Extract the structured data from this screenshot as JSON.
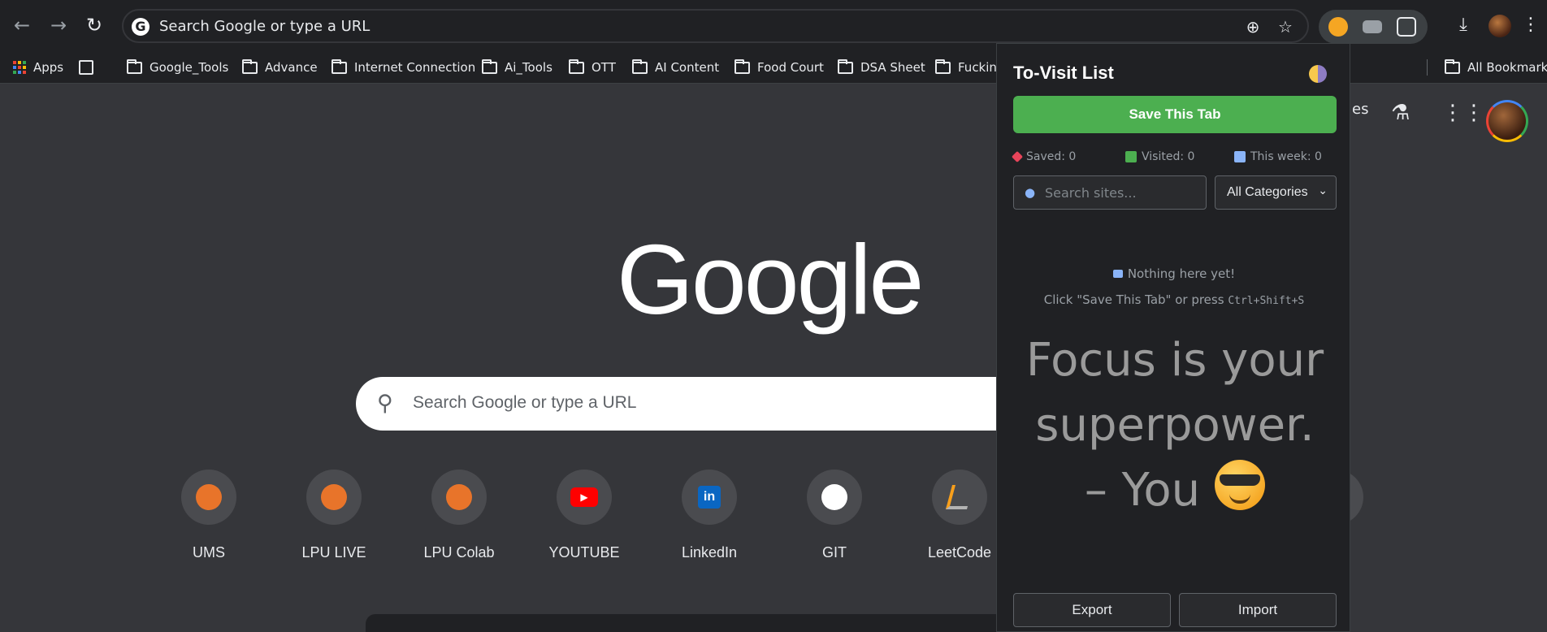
{
  "browser": {
    "omnibox_text": "Search Google or type a URL",
    "bookmarks": [
      {
        "label": "Apps",
        "icon": "apps-icon"
      },
      {
        "label": "Google_Tools",
        "icon": "folder-icon"
      },
      {
        "label": "Advance",
        "icon": "folder-icon"
      },
      {
        "label": "Internet Connection",
        "icon": "folder-icon"
      },
      {
        "label": "Ai_Tools",
        "icon": "folder-icon"
      },
      {
        "label": "OTT",
        "icon": "folder-icon"
      },
      {
        "label": "AI Content",
        "icon": "folder-icon"
      },
      {
        "label": "Food Court",
        "icon": "folder-icon"
      },
      {
        "label": "DSA Sheet",
        "icon": "folder-icon"
      },
      {
        "label": "Fuckin",
        "icon": "folder-icon"
      }
    ],
    "all_bookmarks": "All Bookmarks"
  },
  "newtab": {
    "logo_text": "Google",
    "search_placeholder": "Search Google or type a URL",
    "right_partial_text": "es",
    "shortcuts": [
      {
        "label": "UMS",
        "color": "#e8742a"
      },
      {
        "label": "LPU LIVE",
        "color": "#e8742a"
      },
      {
        "label": "LPU Colab",
        "color": "#e8742a"
      },
      {
        "label": "YOUTUBE",
        "color": "#ff0000"
      },
      {
        "label": "LinkedIn",
        "color": "#0a66c2"
      },
      {
        "label": "GIT",
        "color": "#ffffff"
      },
      {
        "label": "LeetCode",
        "color": "#f89f1b"
      }
    ]
  },
  "popup": {
    "title": "To-Visit List",
    "save_button": "Save This Tab",
    "stats": [
      {
        "label": "Saved: 0",
        "icon": "pin-icon",
        "color": "#e8445a"
      },
      {
        "label": "Visited: 0",
        "icon": "checkbox-icon",
        "color": "#4caf50"
      },
      {
        "label": "This week: 0",
        "icon": "calendar-icon",
        "color": "#8ab4f8"
      }
    ],
    "search_placeholder": "Search sites...",
    "category_value": "All Categories",
    "empty_title": "Nothing here yet!",
    "empty_hint_prefix": "Click \"Save This Tab\" or press",
    "empty_hint_shortcut": "Ctrl+Shift+S",
    "quote_line1": "Focus is your",
    "quote_line2": "superpower.",
    "quote_line3": "– You",
    "export_button": "Export",
    "import_button": "Import"
  }
}
